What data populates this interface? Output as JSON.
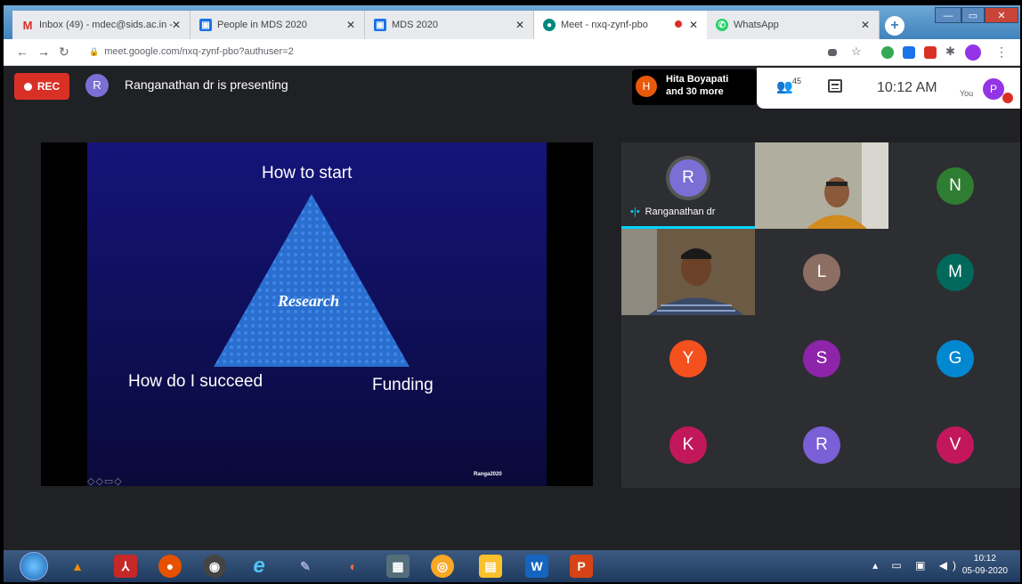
{
  "browser": {
    "tabs": [
      {
        "title": "Inbox (49) - mdec@sids.ac.in -",
        "favicon": "gmail-icon",
        "color": "#d93025",
        "glyph": "M",
        "active": false
      },
      {
        "title": "People in MDS 2020",
        "favicon": "classroom-icon",
        "color": "#1a73e8",
        "glyph": "▣",
        "active": false
      },
      {
        "title": "MDS 2020",
        "favicon": "classroom-icon",
        "color": "#1a73e8",
        "glyph": "▣",
        "active": false
      },
      {
        "title": "Meet - nxq-zynf-pbo",
        "favicon": "meet-icon",
        "color": "#00897b",
        "glyph": "◉",
        "active": true
      },
      {
        "title": "WhatsApp",
        "favicon": "whatsapp-icon",
        "color": "#25d366",
        "glyph": "✆",
        "active": false
      }
    ],
    "url": "meet.google.com/nxq-zynf-pbo?authuser=2"
  },
  "meet": {
    "rec_label": "REC",
    "presenter_initial": "R",
    "presenting_text": "Ranganathan dr is presenting",
    "chip_initial": "H",
    "chip_line1": "Hita Boyapati",
    "chip_line2": "and 30 more",
    "people_count": "45",
    "clock": "10:12 AM",
    "you_label": "You",
    "self_initial": "P"
  },
  "slide": {
    "top": "How to start",
    "center": "Research",
    "left": "How do I succeed",
    "right": "Funding",
    "footer": "Ranga2020",
    "nav": "◇◇▭◇"
  },
  "participants": [
    {
      "initial": "R",
      "color": "#7b6fd6",
      "name": "Ranganathan dr",
      "speaking": true
    },
    {
      "initial": "",
      "color": "",
      "video": "female",
      "name": ""
    },
    {
      "initial": "N",
      "color": "#2e7d32",
      "name": ""
    },
    {
      "initial": "",
      "color": "",
      "video": "male",
      "name": ""
    },
    {
      "initial": "L",
      "color": "#8d6e63",
      "name": ""
    },
    {
      "initial": "M",
      "color": "#00695c",
      "name": ""
    },
    {
      "initial": "Y",
      "color": "#f4511e",
      "name": ""
    },
    {
      "initial": "S",
      "color": "#8e24aa",
      "name": ""
    },
    {
      "initial": "G",
      "color": "#0288d1",
      "name": ""
    },
    {
      "initial": "K",
      "color": "#c2185b",
      "name": ""
    },
    {
      "initial": "R",
      "color": "#7b5fd6",
      "name": ""
    },
    {
      "initial": "V",
      "color": "#c2185b",
      "name": ""
    }
  ],
  "taskbar": {
    "time": "10:12",
    "date": "05-09-2020",
    "apps": [
      {
        "name": "vlc-icon",
        "color": "#f08c00",
        "glyph": "▲"
      },
      {
        "name": "acrobat-icon",
        "color": "#c62828",
        "glyph": "⅄"
      },
      {
        "name": "firefox-icon",
        "color": "#e65100",
        "glyph": "●"
      },
      {
        "name": "camera-icon",
        "color": "#444",
        "glyph": "◉"
      },
      {
        "name": "ie-icon",
        "color": "#1e88e5",
        "glyph": "e"
      },
      {
        "name": "paint-icon",
        "color": "#5c6bc0",
        "glyph": "✎"
      },
      {
        "name": "media-icon",
        "color": "#d84315",
        "glyph": "◐"
      },
      {
        "name": "photos-icon",
        "color": "#546e7a",
        "glyph": "▦"
      },
      {
        "name": "chrome-icon",
        "color": "#f9a825",
        "glyph": "◎"
      },
      {
        "name": "explorer-icon",
        "color": "#fbc02d",
        "glyph": "▤"
      },
      {
        "name": "word-icon",
        "color": "#1565c0",
        "glyph": "W"
      },
      {
        "name": "powerpoint-icon",
        "color": "#d84315",
        "glyph": "P"
      }
    ]
  }
}
